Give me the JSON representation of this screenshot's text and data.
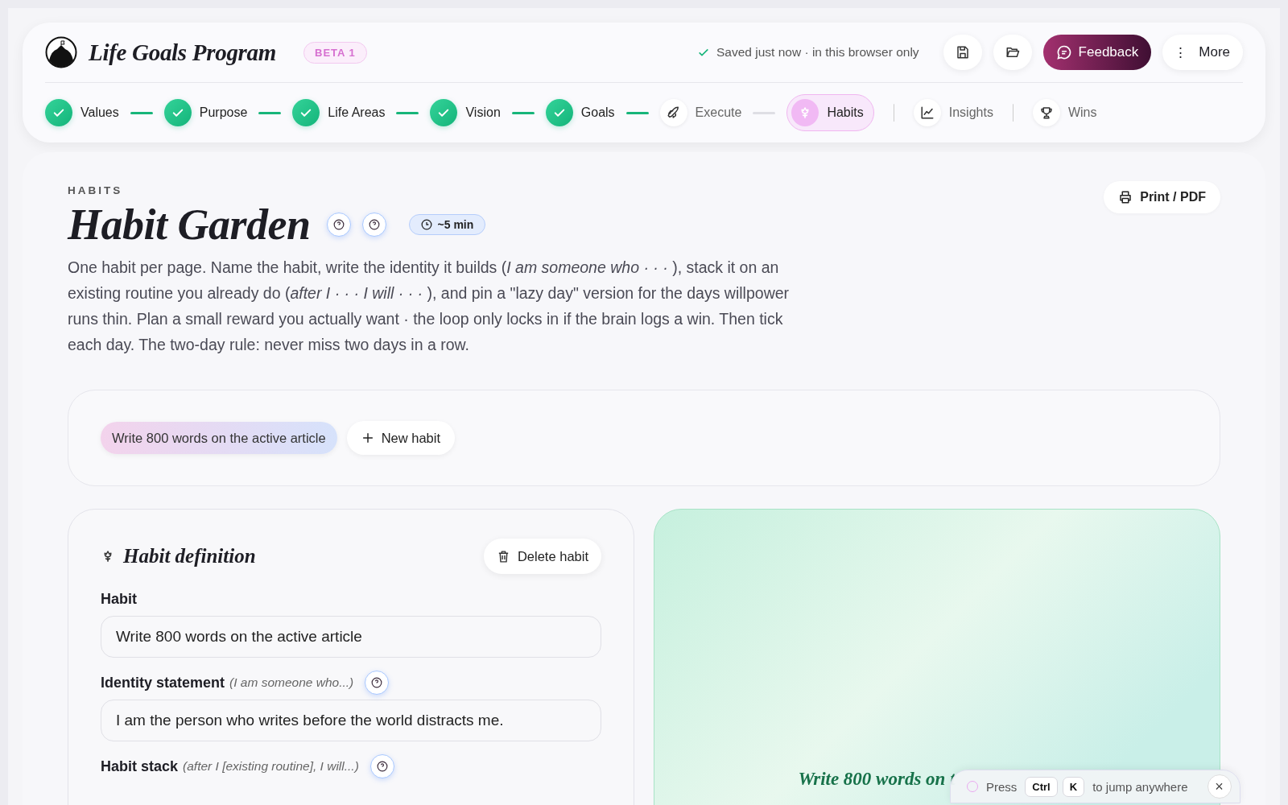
{
  "app": {
    "title": "Life Goals Program",
    "badge": "BETA 1",
    "save_status": "Saved just now · in this browser only",
    "feedback": "Feedback",
    "more": "More",
    "more_icon": "⋮"
  },
  "steps": [
    {
      "kind": "done",
      "label": "Values",
      "selected": false
    },
    {
      "kind": "line",
      "done": true
    },
    {
      "kind": "done",
      "label": "Purpose",
      "selected": false
    },
    {
      "kind": "line",
      "done": true
    },
    {
      "kind": "done",
      "label": "Life Areas",
      "selected": false
    },
    {
      "kind": "line",
      "done": true
    },
    {
      "kind": "done",
      "label": "Vision",
      "selected": false
    },
    {
      "kind": "line",
      "done": true
    },
    {
      "kind": "done",
      "label": "Goals",
      "selected": false
    },
    {
      "kind": "line",
      "done": true
    },
    {
      "kind": "rocket",
      "label": "Execute",
      "selected": false
    },
    {
      "kind": "line",
      "done": false
    },
    {
      "kind": "flower",
      "label": "Habits",
      "selected": true
    },
    {
      "kind": "divider"
    },
    {
      "kind": "chart",
      "label": "Insights",
      "selected": false
    },
    {
      "kind": "divider"
    },
    {
      "kind": "trophy",
      "label": "Wins",
      "selected": false
    }
  ],
  "page": {
    "eyebrow": "HABITS",
    "title": "Habit Garden",
    "duration": "~5 min",
    "print": "Print / PDF",
    "description": "One habit per page. Name the habit, write the identity it builds (*I am someone who · · ·* ), stack it on an existing routine you already do (*after I · · · I will · · ·* ), and pin a \"lazy day\" version for the days willpower runs thin. Plan a small reward you actually want · the loop only locks in if the brain logs a win. Then tick each day. The two-day rule: never miss two days in a row."
  },
  "habit_tabs": [
    {
      "label": "Write 800 words on the active article",
      "selected": true
    }
  ],
  "new_habit": "New habit",
  "definition": {
    "title": "Habit definition",
    "delete": "Delete habit",
    "fields": [
      {
        "label": "Habit",
        "value": "Write 800 words on the active article"
      },
      {
        "label": "Identity statement",
        "hint": "(I am someone who...)",
        "help": true,
        "value": "I am the person who writes before the world distracts me."
      },
      {
        "label": "Habit stack",
        "hint": "(after I [existing routine], I will...)",
        "help": true
      }
    ]
  },
  "preview": {
    "title": "Write 800 words on t"
  },
  "toast": {
    "before": "Press",
    "keys": [
      "Ctrl",
      "K"
    ],
    "after": "to jump anywhere",
    "close": "×"
  }
}
